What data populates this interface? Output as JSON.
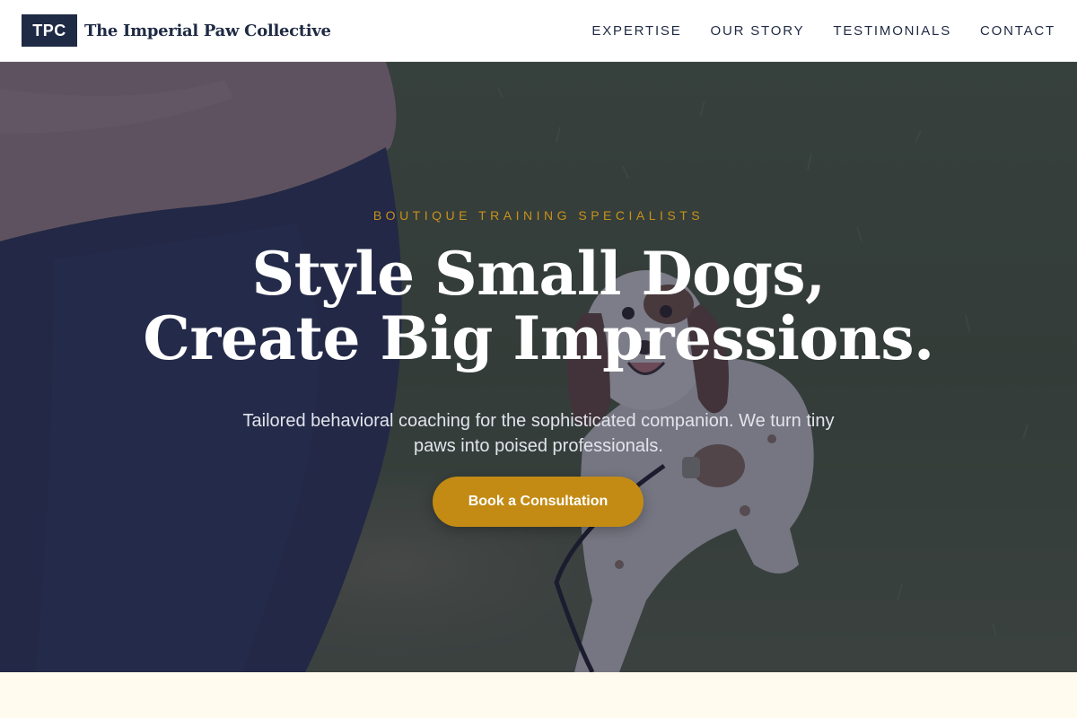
{
  "header": {
    "logo_mark": "TPC",
    "brand_name": "The Imperial Paw Collective",
    "nav": [
      {
        "label": "EXPERTISE"
      },
      {
        "label": "OUR STORY"
      },
      {
        "label": "TESTIMONIALS"
      },
      {
        "label": "CONTACT"
      }
    ]
  },
  "hero": {
    "eyebrow": "BOUTIQUE TRAINING SPECIALISTS",
    "headline_line1": "Style Small Dogs,",
    "headline_line2": "Create Big Impressions.",
    "subtext": "Tailored behavioral coaching for the sophisticated companion. We turn tiny paws into poised professionals.",
    "cta_label": "Book a Consultation"
  },
  "colors": {
    "navy": "#1f2a44",
    "gold_accent": "#c38b14",
    "cream_background": "#fffcef"
  }
}
